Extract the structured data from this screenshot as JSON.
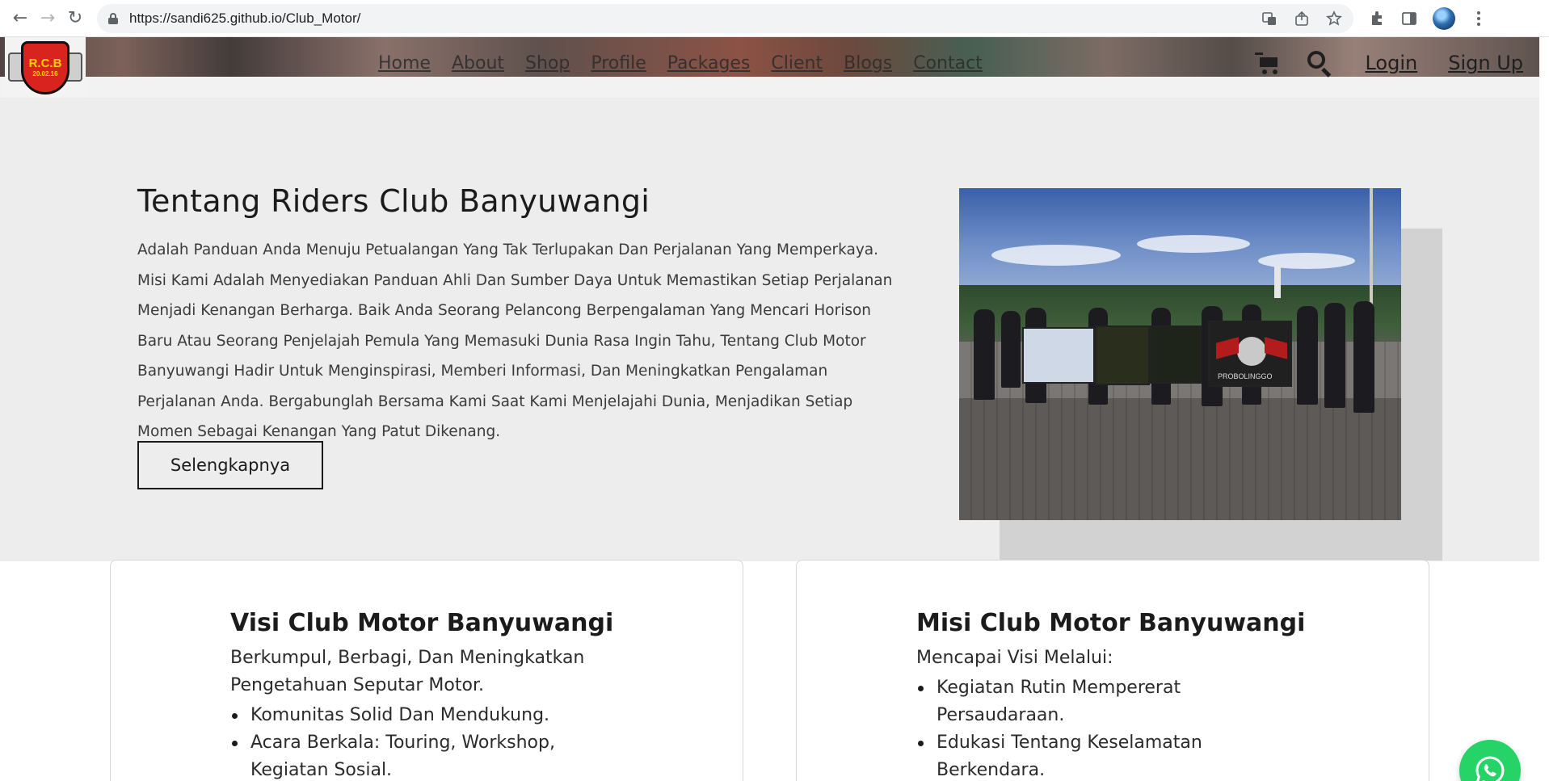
{
  "browser": {
    "url": "https://sandi625.github.io/Club_Motor/",
    "back_icon": "←",
    "forward_icon": "→",
    "reload_icon": "↻"
  },
  "header": {
    "logo": {
      "text": "R.C.B",
      "date": "20.02.16"
    },
    "nav": [
      "Home",
      "About",
      "Shop",
      "Profile",
      "Packages",
      "Client",
      "Blogs",
      "Contact"
    ],
    "login_label": "Login",
    "signup_label": "Sign Up"
  },
  "about": {
    "title": "Tentang Riders Club Banyuwangi",
    "text": "Adalah Panduan Anda Menuju Petualangan Yang Tak Terlupakan Dan Perjalanan Yang Memperkaya. Misi Kami Adalah Menyediakan Panduan Ahli Dan Sumber Daya Untuk Memastikan Setiap Perjalanan Menjadi Kenangan Berharga. Baik Anda Seorang Pelancong Berpengalaman Yang Mencari Horison Baru Atau Seorang Penjelajah Pemula Yang Memasuki Dunia Rasa Ingin Tahu, Tentang Club Motor Banyuwangi Hadir Untuk Menginspirasi, Memberi Informasi, Dan Meningkatkan Pengalaman Perjalanan Anda. Bergabunglah Bersama Kami Saat Kami Menjelajahi Dunia, Menjadikan Setiap Momen Sebagai Kenangan Yang Patut Dikenang.",
    "button_label": "Selengkapnya",
    "photo_banner_text": "PROBOLINGGO"
  },
  "visi": {
    "title": "Visi Club Motor Banyuwangi",
    "subtitle": "Berkumpul, Berbagi, Dan Meningkatkan Pengetahuan Seputar Motor.",
    "items": [
      "Komunitas Solid Dan Mendukung.",
      "Acara Berkala: Touring, Workshop, Kegiatan Sosial."
    ]
  },
  "misi": {
    "title": "Misi Club Motor Banyuwangi",
    "subtitle": "Mencapai Visi Melalui:",
    "items": [
      "Kegiatan Rutin Mempererat Persaudaraan.",
      "Edukasi Tentang Keselamatan Berkendara."
    ]
  },
  "colors": {
    "whatsapp": "#25d366",
    "about_bg": "#ededed",
    "logo_red": "#d8231e",
    "logo_yellow": "#ffd200"
  }
}
